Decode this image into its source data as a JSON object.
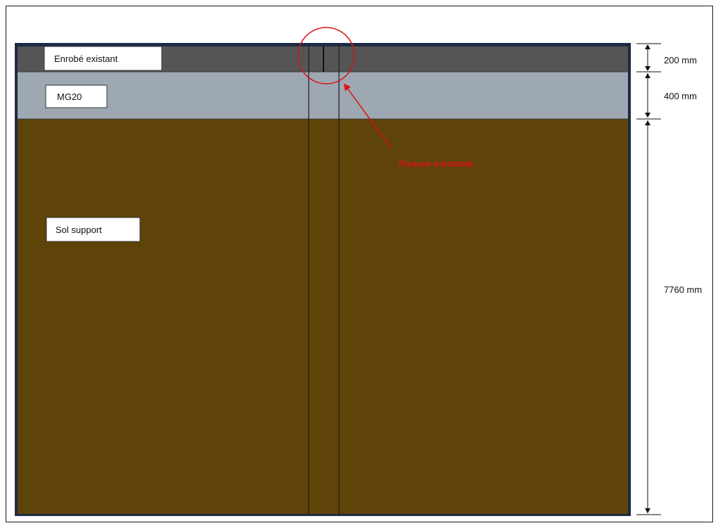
{
  "layers": {
    "enrobe": {
      "label": "Enrobé existant",
      "color": "#555555"
    },
    "mg20": {
      "label": "MG20",
      "color": "#9ea8b2"
    },
    "sol": {
      "label": "Sol support",
      "color": "#5e4409"
    }
  },
  "dimensions": {
    "enrobe_thickness": "200 mm",
    "mg20_thickness": "400 mm",
    "sol_thickness": "7760 mm"
  },
  "annotation": {
    "text": "Fissure existante",
    "color": "#dd1111"
  },
  "colors": {
    "border": "#1e2b44",
    "dimension_line": "#111111"
  }
}
